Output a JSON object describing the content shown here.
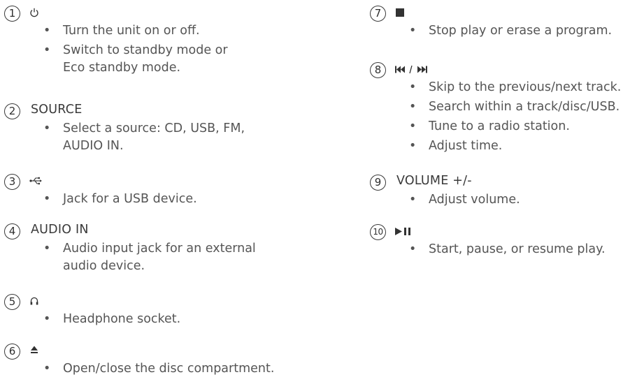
{
  "left_column": [
    {
      "number": "1",
      "icon": "power-icon",
      "title": "",
      "bullets": [
        "Turn the unit on or off.",
        "Switch to standby mode or Eco standby mode."
      ]
    },
    {
      "number": "2",
      "icon": "",
      "title": "SOURCE",
      "bullets": [
        "Select a source: CD, USB, FM, AUDIO IN."
      ]
    },
    {
      "number": "3",
      "icon": "usb-icon",
      "title": "",
      "bullets": [
        "Jack for a USB device."
      ]
    },
    {
      "number": "4",
      "icon": "",
      "title": "AUDIO IN",
      "bullets": [
        "Audio input jack for an external audio device."
      ]
    },
    {
      "number": "5",
      "icon": "headphone-icon",
      "title": "",
      "bullets": [
        "Headphone socket."
      ]
    },
    {
      "number": "6",
      "icon": "eject-icon",
      "title": "",
      "bullets": [
        "Open/close the disc compartment."
      ]
    }
  ],
  "right_column": [
    {
      "number": "7",
      "icon": "stop-icon",
      "title": "",
      "bullets": [
        "Stop play or erase a program."
      ]
    },
    {
      "number": "8",
      "icon": "prev-next-icon",
      "title": "",
      "bullets": [
        "Skip to the previous/next track.",
        "Search within a track/disc/USB.",
        "Tune to a radio station.",
        "Adjust time."
      ]
    },
    {
      "number": "9",
      "icon": "",
      "title": "VOLUME +/-",
      "bullets": [
        "Adjust volume."
      ]
    },
    {
      "number": "10",
      "icon": "play-pause-icon",
      "title": "",
      "bullets": [
        "Start, pause, or resume play."
      ]
    }
  ]
}
